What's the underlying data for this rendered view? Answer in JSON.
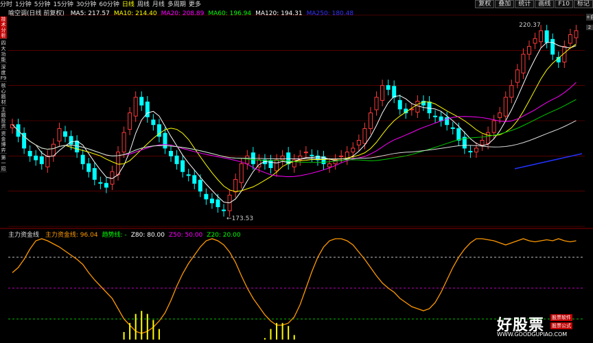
{
  "toolbar": {
    "items": [
      "分时",
      "1分钟",
      "5分钟",
      "15分钟",
      "30分钟",
      "60分钟",
      "日线",
      "周线",
      "月线",
      "多周期",
      "更多"
    ],
    "active_index": 6,
    "right_buttons": [
      "复权",
      "叠加",
      "统计",
      "画线",
      "F10",
      "标记"
    ]
  },
  "side_tabs": [
    "技术分析",
    "四大功能",
    "深度F9",
    "核心题材",
    "主题投资",
    "资金博弈",
    "第一招"
  ],
  "right_strip": [
    "+自",
    "2"
  ],
  "main_legend": {
    "title": "喻空调(日线 前复权)",
    "ma": [
      {
        "label": "MA5: 217.57",
        "color": "#ffffff"
      },
      {
        "label": "MA10: 214.40",
        "color": "#ffff00"
      },
      {
        "label": "MA20: 208.89",
        "color": "#ff00ff"
      },
      {
        "label": "MA60: 196.94",
        "color": "#00ff00"
      },
      {
        "label": "MA120: 194.31",
        "color": "#ffffff"
      },
      {
        "label": "MA250: 180.48",
        "color": "#3333ff"
      }
    ]
  },
  "price_labels": {
    "high": "220.37",
    "low": "173.53"
  },
  "indicator_legend": {
    "name": "主力资金线",
    "items": [
      {
        "label": "主力资金线: 96.04",
        "color": "#ff9900"
      },
      {
        "label": "趋势线: -",
        "color": "#00ff00"
      },
      {
        "label": "Z80: 80.00",
        "color": "#ffffff"
      },
      {
        "label": "Z50: 50.00",
        "color": "#ff00ff"
      },
      {
        "label": "Z20: 20.00",
        "color": "#00ff00"
      }
    ]
  },
  "watermark": {
    "logo": "好股票",
    "url": "WWW.GOODGUPIAO.COM",
    "side": [
      "股票软件",
      "股票公式"
    ]
  },
  "chart_data": {
    "type": "line",
    "title": "",
    "closes": [
      196,
      193,
      190,
      188,
      187,
      186,
      188,
      191,
      195,
      193,
      191,
      189,
      186,
      184,
      182,
      181,
      180,
      184,
      189,
      194,
      199,
      203,
      201,
      198,
      196,
      193,
      190,
      188,
      186,
      184,
      183,
      181,
      179,
      177,
      176,
      175,
      174,
      178,
      182,
      186,
      188,
      186,
      187,
      186,
      185,
      187,
      188,
      186,
      187,
      188,
      189,
      188,
      187,
      186,
      186,
      187,
      188,
      189,
      190,
      192,
      195,
      199,
      203,
      206,
      205,
      203,
      200,
      199,
      200,
      202,
      201,
      199,
      198,
      197,
      196,
      195,
      192,
      190,
      189,
      190,
      192,
      194,
      197,
      199,
      203,
      206,
      210,
      214,
      216,
      218,
      220,
      217,
      214,
      212,
      216,
      219,
      220
    ],
    "oscillator": [
      65,
      70,
      78,
      88,
      96,
      98,
      96,
      93,
      90,
      86,
      82,
      78,
      73,
      65,
      58,
      52,
      46,
      40,
      30,
      20,
      14,
      8,
      6,
      8,
      12,
      18,
      26,
      38,
      52,
      64,
      74,
      82,
      90,
      96,
      98,
      96,
      92,
      85,
      75,
      62,
      50,
      40,
      32,
      24,
      18,
      14,
      14,
      16,
      22,
      34,
      50,
      66,
      80,
      90,
      96,
      98,
      98,
      96,
      92,
      85,
      78,
      70,
      62,
      55,
      50,
      46,
      40,
      36,
      32,
      30,
      28,
      30,
      36,
      46,
      58,
      70,
      80,
      88,
      94,
      98,
      98,
      97,
      96,
      94,
      92,
      94,
      96,
      98,
      96,
      95,
      96,
      97,
      96,
      98,
      96,
      95,
      96
    ],
    "zones": {
      "z80": 80,
      "z50": 50,
      "z20": 20
    }
  }
}
